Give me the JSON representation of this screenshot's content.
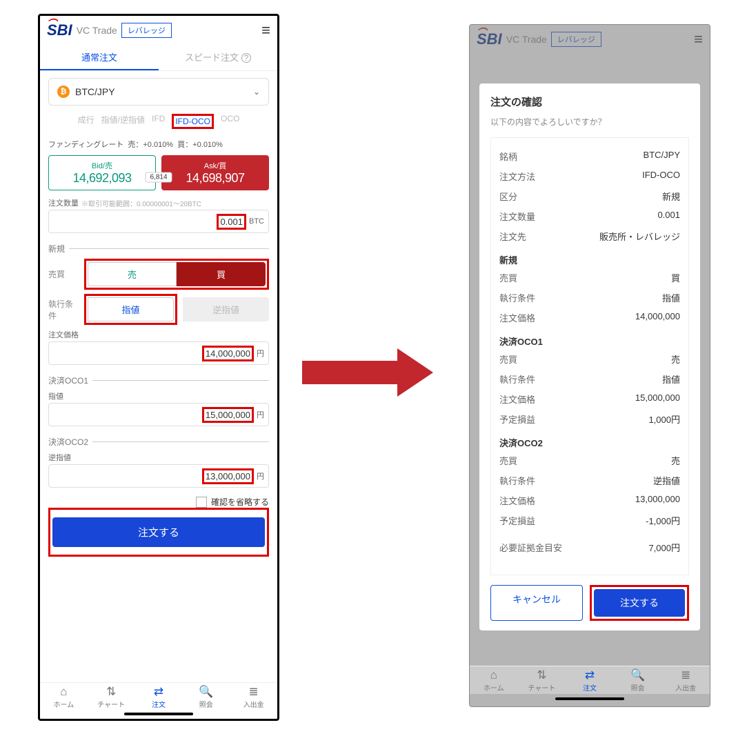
{
  "brand": {
    "sbi": "SBI",
    "vc": "VC Trade",
    "leverage_badge": "レバレッジ"
  },
  "top_tabs": {
    "normal": "通常注文",
    "speed": "スピード注文"
  },
  "pair": {
    "symbol": "BTC/JPY"
  },
  "order_methods": {
    "market": "成行",
    "limit": "指値/逆指値",
    "ifd": "IFD",
    "ifdoco": "IFD-OCO",
    "oco": "OCO"
  },
  "funding": {
    "label": "ファンディングレート",
    "sell": "売：+0.010%",
    "buy": "買：+0.010%"
  },
  "quotes": {
    "bid_label": "Bid/売",
    "bid_value": "14,692,093",
    "ask_label": "Ask/買",
    "ask_value": "14,698,907",
    "spread": "6,814"
  },
  "qty": {
    "label": "注文数量",
    "note": "※取引可能範囲：0.00000001〜20BTC",
    "value": "0.001",
    "unit": "BTC"
  },
  "sections": {
    "new": "新規",
    "oco1": "決済OCO1",
    "oco2": "決済OCO2"
  },
  "side": {
    "label": "売買",
    "sell": "売",
    "buy": "買"
  },
  "cond": {
    "label": "執行条件",
    "limit": "指値",
    "stop": "逆指値"
  },
  "price": {
    "label": "注文価格",
    "new_value": "14,000,000",
    "oco1_value": "15,000,000",
    "oco2_value": "13,000,000",
    "unit": "円"
  },
  "oco_labels": {
    "limit": "指値",
    "stop": "逆指値"
  },
  "skip_confirm": "確認を省略する",
  "submit": "注文する",
  "nav": {
    "home": "ホーム",
    "chart": "チャート",
    "order": "注文",
    "inquiry": "照会",
    "funds": "入出金"
  },
  "confirm": {
    "title": "注文の確認",
    "sub": "以下の内容でよろしいですか？",
    "rows": {
      "symbol_k": "銘柄",
      "symbol_v": "BTC/JPY",
      "method_k": "注文方法",
      "method_v": "IFD-OCO",
      "kubun_k": "区分",
      "kubun_v": "新規",
      "qty_k": "注文数量",
      "qty_v": "0.001",
      "dest_k": "注文先",
      "dest_v": "販売所・レバレッジ"
    },
    "new": {
      "side_k": "売買",
      "side_v": "買",
      "cond_k": "執行条件",
      "cond_v": "指値",
      "price_k": "注文価格",
      "price_v": "14,000,000"
    },
    "oco1": {
      "side_k": "売買",
      "side_v": "売",
      "cond_k": "執行条件",
      "cond_v": "指値",
      "price_k": "注文価格",
      "price_v": "15,000,000",
      "pl_k": "予定損益",
      "pl_v": "1,000円"
    },
    "oco2": {
      "side_k": "売買",
      "side_v": "売",
      "cond_k": "執行条件",
      "cond_v": "逆指値",
      "price_k": "注文価格",
      "price_v": "13,000,000",
      "pl_k": "予定損益",
      "pl_v": "-1,000円"
    },
    "margin_k": "必要証拠金目安",
    "margin_v": "7,000円",
    "cancel": "キャンセル",
    "confirm_btn": "注文する"
  }
}
